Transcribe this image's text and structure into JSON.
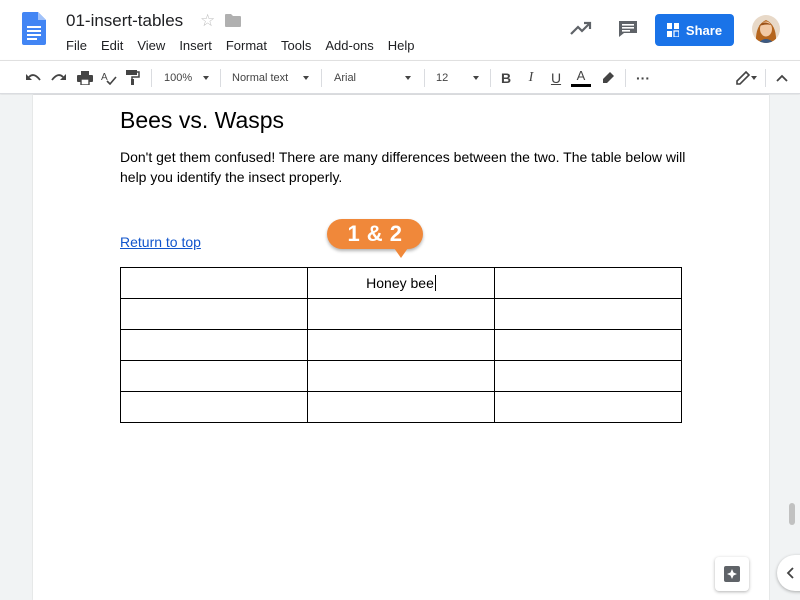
{
  "app": {
    "doc_title": "01-insert-tables"
  },
  "menu": [
    "File",
    "Edit",
    "View",
    "Insert",
    "Format",
    "Tools",
    "Add-ons",
    "Help"
  ],
  "header": {
    "share_label": "Share"
  },
  "toolbar": {
    "zoom": "100%",
    "style": "Normal text",
    "font": "Arial",
    "size": "12"
  },
  "document": {
    "heading": "Bees vs. Wasps",
    "paragraph": "Don't get them confused! There are many differences between the two. The table below will help you identify the insect properly.",
    "link": "Return to top",
    "table": [
      [
        "",
        "Honey bee",
        ""
      ],
      [
        "",
        "",
        ""
      ],
      [
        "",
        "",
        ""
      ],
      [
        "",
        "",
        ""
      ],
      [
        "",
        "",
        ""
      ]
    ]
  },
  "callout": "1 & 2",
  "colors": {
    "accent": "#1a73e8",
    "callout": "#f0883a",
    "link": "#1155cc"
  },
  "icons": [
    "docs-logo-icon",
    "star-icon",
    "folder-icon",
    "trending-icon",
    "comment-icon",
    "lock-icon",
    "undo-icon",
    "redo-icon",
    "print-icon",
    "spellcheck-icon",
    "paint-format-icon",
    "bold-icon",
    "italic-icon",
    "underline-icon",
    "text-color-icon",
    "highlight-icon",
    "more-icon",
    "edit-mode-icon",
    "collapse-icon",
    "explore-icon",
    "chevron-left-icon"
  ]
}
